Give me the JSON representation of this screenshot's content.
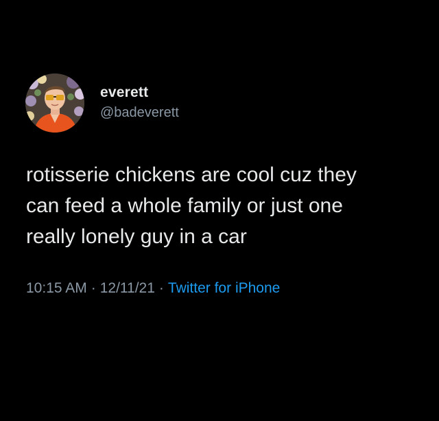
{
  "author": {
    "display_name": "everett",
    "handle": "@badeverett",
    "avatar_icon": "profile-photo"
  },
  "tweet": {
    "text": "rotisserie chickens are cool cuz they\ncan feed a whole family or just one\nreally lonely guy in a car",
    "time": "10:15 AM",
    "date": "12/11/21",
    "separator": "·",
    "source": "Twitter for iPhone"
  },
  "colors": {
    "background": "#000000",
    "text_primary": "#e7e9ea",
    "text_secondary": "#8b98a5",
    "link": "#1d9bf0"
  }
}
